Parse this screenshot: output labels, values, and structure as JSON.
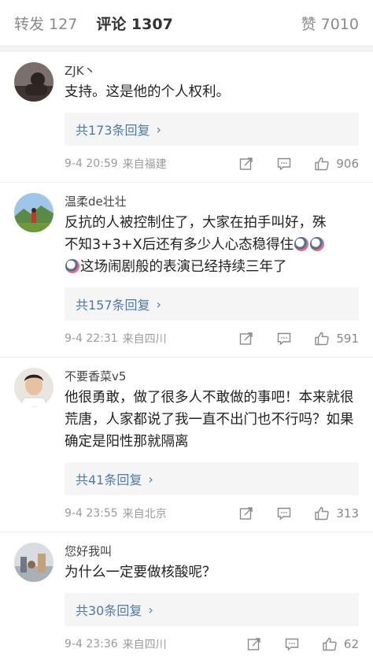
{
  "tabs": {
    "reposts": "转发 127",
    "comments": "评论 1307",
    "likes": "赞 7010"
  },
  "comments": [
    {
      "user": "ZJK丶",
      "text": "支持。这是他的个人权利。",
      "replies": "共173条回复",
      "time": "9-4 20:59",
      "source": "来自福建",
      "likes": "906"
    },
    {
      "user": "温柔de壮壮",
      "text_line1": "反抗的人被控制住了，大家在拍手叫好，殊",
      "text_line2": "不知3+3+X后还有多少人心态稳得住",
      "text_line3": "这场闹剧般的表演已经持续三年了",
      "replies": "共157条回复",
      "time": "9-4 22:31",
      "source": "来自四川",
      "likes": "591"
    },
    {
      "user": "不要香菜v5",
      "text": "他很勇敢，做了很多人不敢做的事吧！本来就很荒唐，人家都说了我一直不出门也不行吗？如果确定是阳性那就隔离",
      "replies": "共41条回复",
      "time": "9-4 23:55",
      "source": "来自北京",
      "likes": "313"
    },
    {
      "user": "您好我叫",
      "text": "为什么一定要做核酸呢？",
      "replies": "共30条回复",
      "time": "9-4 23:36",
      "source": "来自四川",
      "likes": "62"
    }
  ],
  "icons": {
    "share": "share-icon",
    "comment": "comment-icon",
    "like": "thumbs-up-icon",
    "reply_chevron": "chevron-right-icon"
  },
  "colors": {
    "link": "#4f7aa7",
    "reply_bg": "#f5f5f5"
  }
}
